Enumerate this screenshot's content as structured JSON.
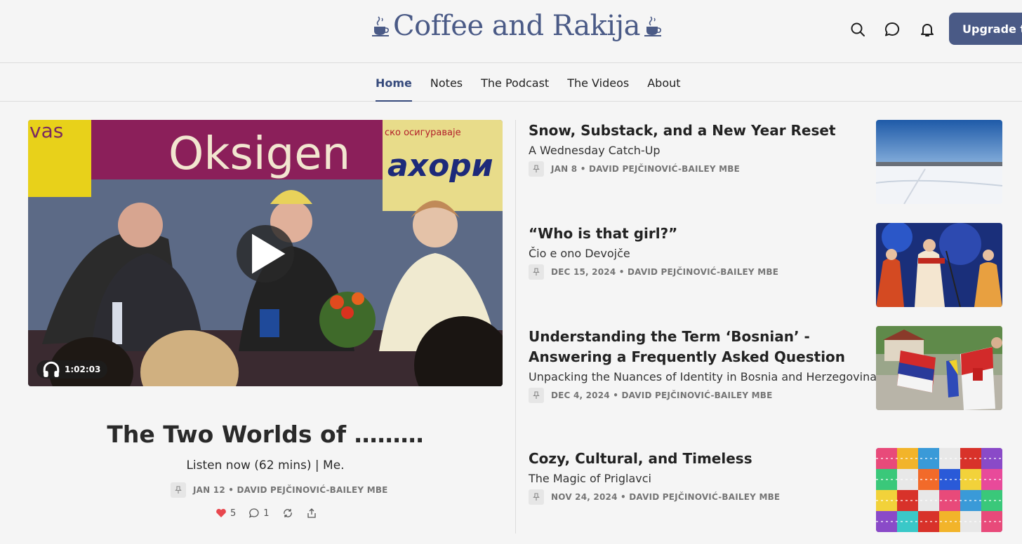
{
  "brand": {
    "title": "Coffee and Rakija"
  },
  "header": {
    "upgrade_label": "Upgrade to"
  },
  "nav": {
    "tabs": [
      "Home",
      "Notes",
      "The Podcast",
      "The Videos",
      "About"
    ],
    "active": "Home"
  },
  "hero": {
    "sign_text": "Oksigen",
    "sign_left": "vas",
    "sign_right": "ахори",
    "sign_right_top": "ско осигураваје",
    "duration": "1:02:03",
    "title": "The Two Worlds of ………",
    "subtitle": "Listen now (62 mins) | Me.",
    "meta": "JAN 12 • DAVID PEJČINOVIĆ-BAILEY MBE",
    "likes": "5",
    "comments": "1"
  },
  "posts": [
    {
      "title": "Snow, Substack, and a New Year Reset",
      "subtitle": "A Wednesday Catch-Up",
      "meta": "JAN 8 • DAVID PEJČINOVIĆ-BAILEY MBE"
    },
    {
      "title": "“Who is that girl?”",
      "subtitle": "Čio e ono Devojče",
      "meta": "DEC 15, 2024 • DAVID PEJČINOVIĆ-BAILEY MBE"
    },
    {
      "title": "Understanding the Term ‘Bosnian’ - Answering a Frequently Asked Question",
      "subtitle": "Unpacking the Nuances of Identity in Bosnia and Herzegovina",
      "meta": "DEC 4, 2024 • DAVID PEJČINOVIĆ-BAILEY MBE"
    },
    {
      "title": "Cozy, Cultural, and Timeless",
      "subtitle": "The Magic of Priglavci",
      "meta": "NOV 24, 2024 • DAVID PEJČINOVIĆ-BAILEY MBE"
    }
  ],
  "colors": {
    "brand": "#4a5a86",
    "accent": "#364a7c",
    "heart": "#e8474e"
  },
  "icons": {
    "search": "search-icon",
    "chat": "chat-icon",
    "bell": "bell-icon",
    "pin": "pin-icon",
    "play": "play-icon",
    "headphones": "headphones-icon"
  }
}
